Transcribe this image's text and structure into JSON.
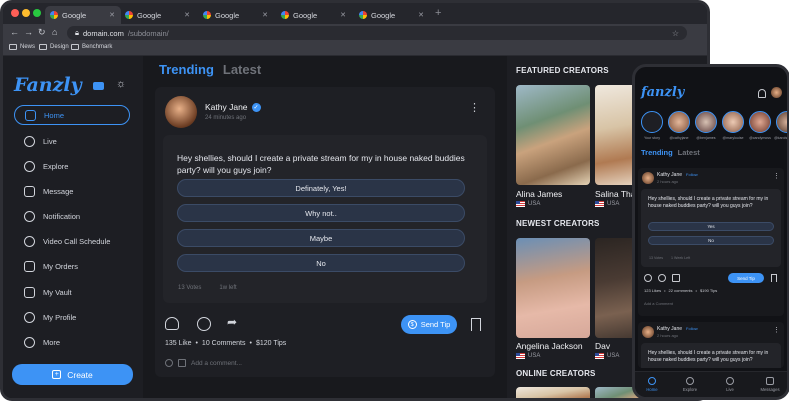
{
  "browser": {
    "tabs": [
      {
        "label": "Google"
      },
      {
        "label": "Google"
      },
      {
        "label": "Google"
      },
      {
        "label": "Google"
      },
      {
        "label": "Google"
      }
    ],
    "url_domain": "domain.com",
    "url_path": "/subdomain/",
    "bookmarks": [
      "News",
      "Design",
      "Benchmark"
    ]
  },
  "sidebar": {
    "logo": "Fanzly",
    "items": [
      {
        "label": "Home"
      },
      {
        "label": "Live"
      },
      {
        "label": "Explore"
      },
      {
        "label": "Message"
      },
      {
        "label": "Notification"
      },
      {
        "label": "Video Call Schedule"
      },
      {
        "label": "My Orders"
      },
      {
        "label": "My Vault"
      },
      {
        "label": "My Profile"
      },
      {
        "label": "More"
      }
    ],
    "create_label": "Create"
  },
  "feed": {
    "tab_active": "Trending",
    "tab_inactive": "Latest",
    "post": {
      "author": "Kathy Jane",
      "time": "24 minutes ago",
      "question": "Hey shellies, should I create a private stream for my in house naked buddies party? will you guys join?",
      "options": [
        "Definately, Yes!",
        "Why not..",
        "Maybe",
        "No"
      ],
      "votes": "13 Votes",
      "time_left": "1w left",
      "send_tip_label": "Send Tip",
      "likes": "135 Like",
      "comments": "10  Comments",
      "tips": "$120 Tips",
      "comment_placeholder": "Add a comment..."
    }
  },
  "right_panel": {
    "featured_title": "FEATURED CREATORS",
    "featured": [
      {
        "name": "Alina James",
        "country": "USA"
      },
      {
        "name": "Salina Thar",
        "country": "USA"
      }
    ],
    "newest_title": "NEWEST CREATORS",
    "newest": [
      {
        "name": "Angelina Jackson",
        "country": "USA"
      },
      {
        "name": "Dav",
        "country": "USA"
      }
    ],
    "online_title": "ONLINE CREATORS"
  },
  "phone": {
    "logo": "fanzly",
    "stories": [
      "Your story",
      "@cathyjane",
      "@benjames",
      "@marylouise",
      "@candymoss",
      "@karolsmith",
      "@annasmith"
    ],
    "tab_active": "Trending",
    "tab_inactive": "Latest",
    "posts": [
      {
        "author": "Kathy Jane",
        "follow": "Follow",
        "time": "2 hours ago",
        "question": "Hey shellies, should I create a private stream for my in house naked buddies party? will you guys join?",
        "options": [
          "Yes",
          "No"
        ],
        "votes": "13 Votes",
        "time_left": "1 Week Left",
        "send_tip_label": "Send Tip",
        "likes": "123 Likes",
        "comments": "22 comments",
        "tips": "$190 Tips",
        "comment_placeholder": "Add a Comment"
      },
      {
        "author": "Kathy Jane",
        "follow": "Follow",
        "time": "2 hours ago",
        "question": "Hey shellies, should I create a private stream for my in house naked buddies party? will you guys join?"
      }
    ],
    "nav": [
      {
        "label": "Home"
      },
      {
        "label": "Explore"
      },
      {
        "label": "Live"
      },
      {
        "label": "Messages"
      }
    ]
  },
  "colors": {
    "accent": "#3d93f5",
    "background": "#18191d",
    "surface": "#1e1f24"
  }
}
